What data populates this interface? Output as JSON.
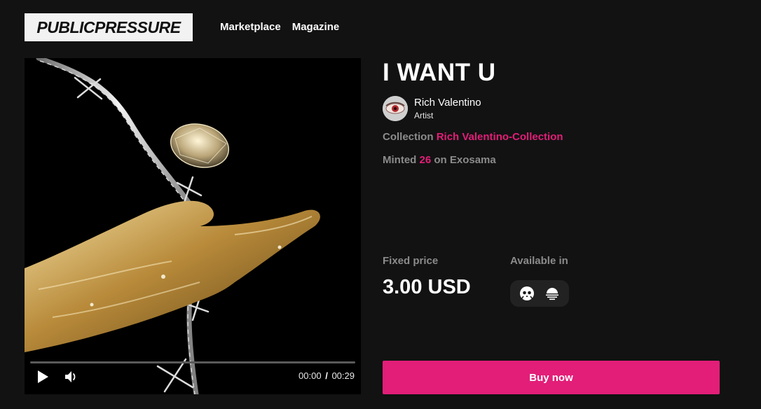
{
  "header": {
    "logo_text": "PUBLICPRESSURE",
    "nav": [
      {
        "label": "Marketplace"
      },
      {
        "label": "Magazine"
      }
    ]
  },
  "player": {
    "current_time": "00:00",
    "separator": "/",
    "duration": "00:29",
    "progress": 0
  },
  "item": {
    "title": "I WANT U",
    "artist_name": "Rich Valentino",
    "artist_role": "Artist",
    "collection_label": "Collection",
    "collection_name": "Rich Valentino-Collection",
    "minted_label": "Minted",
    "minted_count": "26",
    "minted_on": "on Exosama"
  },
  "purchase": {
    "price_label": "Fixed price",
    "price": "3.00 USD",
    "available_label": "Available in",
    "chains": [
      "skull-icon",
      "sunset-icon"
    ],
    "buy_label": "Buy now"
  },
  "colors": {
    "background": "#121212",
    "accent": "#e21e78",
    "muted": "#8b8b8b"
  }
}
